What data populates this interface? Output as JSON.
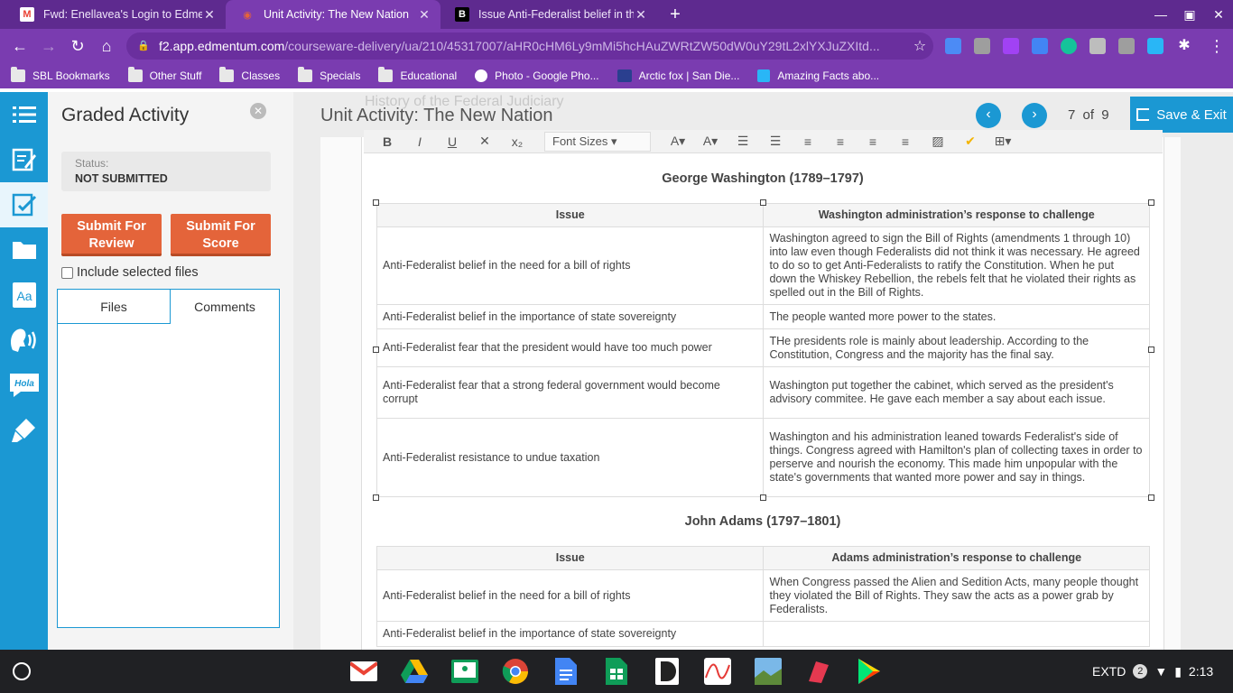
{
  "browser": {
    "tabs": [
      {
        "title": "Fwd: Enellavea's Login to Edmen",
        "favicon": "M"
      },
      {
        "title": "Unit Activity: The New Nation",
        "favicon": "◉"
      },
      {
        "title": "Issue Anti-Federalist belief in the",
        "favicon": "B"
      }
    ],
    "url_host": "f2.app.edmentum.com",
    "url_path": "/courseware-delivery/ua/210/45317007/aHR0cHM6Ly9mMi5hcHAuZWRtZW50dW0uY29tL2xlYXJuZXItd...",
    "bookmarks": [
      "SBL Bookmarks",
      "Other Stuff",
      "Classes",
      "Specials",
      "Educational",
      "Photo - Google Pho...",
      "Arctic fox | San Die...",
      "Amazing Facts abo..."
    ]
  },
  "panel": {
    "title": "Graded Activity",
    "status_label": "Status:",
    "status_value": "NOT SUBMITTED",
    "submit_review": "Submit For Review",
    "submit_score": "Submit For Score",
    "include_files": "Include selected files",
    "tab_files": "Files",
    "tab_comments": "Comments"
  },
  "header": {
    "faded_title": "History of the Federal Judiciary",
    "unit_title": "Unit Activity: The New Nation",
    "page_current": "7",
    "page_of": "of",
    "page_total": "9",
    "save_exit": "Save & Exit"
  },
  "editor": {
    "font_sizes": "Font Sizes"
  },
  "washington": {
    "title": "George Washington (1789–1797)",
    "col_issue": "Issue",
    "col_response": "Washington administration’s response to challenge",
    "rows": [
      {
        "issue": "Anti-Federalist belief in the need for a bill of rights",
        "response": "Washington agreed to sign the Bill of Rights (amendments 1 through 10) into law even though Federalists did not think it was necessary. He agreed to do so to get Anti-Federalists to ratify the Constitution. When he put down the Whiskey Rebellion, the rebels felt that he violated their rights as spelled out in the Bill of Rights."
      },
      {
        "issue": "Anti-Federalist belief in the importance of state sovereignty",
        "response": " The people wanted more power to the states."
      },
      {
        "issue": "Anti-Federalist fear that the president would have too much power",
        "response": " THe presidents role is mainly about leadership. According to the Constitution, Congress and the majority has the final say."
      },
      {
        "issue": "Anti-Federalist fear that a strong federal government would become corrupt",
        "response": " Washington put together the cabinet, which served as the president's advisory commitee. He gave each member a say about each issue."
      },
      {
        "issue": "Anti-Federalist resistance to undue taxation",
        "response": " Washington and his administration leaned towards Federalist's side of things. Congress agreed with Hamilton's plan of collecting taxes in order to perserve and nourish the economy. This made him unpopular with the state's governments that wanted more power and say in things."
      }
    ]
  },
  "adams": {
    "title": "John Adams (1797–1801)",
    "col_issue": "Issue",
    "col_response": "Adams administration’s response to challenge",
    "rows": [
      {
        "issue": "Anti-Federalist belief in the need for a bill of rights",
        "response": "When Congress passed the Alien and Sedition Acts, many people thought they violated the Bill of Rights. They saw the acts as a power grab by Federalists."
      },
      {
        "issue": "Anti-Federalist belief in the importance of state sovereignty",
        "response": ""
      }
    ]
  },
  "shelf": {
    "tray_ime": "EXTD",
    "tray_badge": "2",
    "clock": "2:13"
  }
}
